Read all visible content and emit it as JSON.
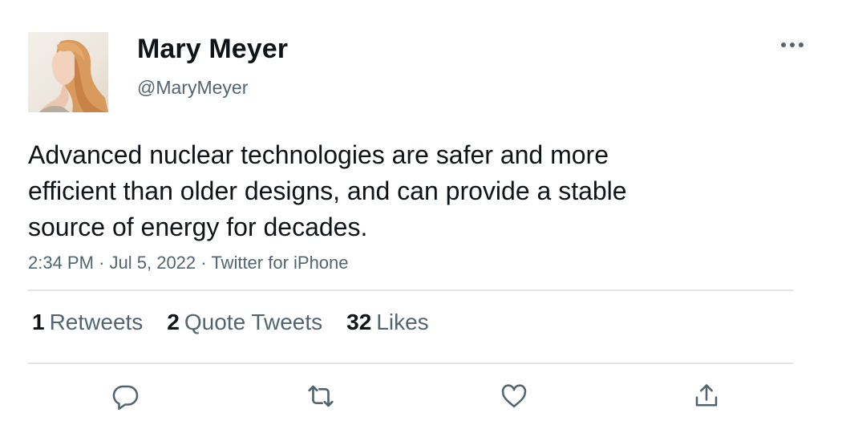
{
  "author": {
    "display_name": "Mary Meyer",
    "handle": "@MaryMeyer"
  },
  "tweet": {
    "text_lines": [
      "Advanced nuclear technologies are safer and more",
      "efficient than older designs, and can provide a stable",
      "source of energy for decades."
    ],
    "time": "2:34 PM",
    "date": "Jul 5, 2022",
    "source": "Twitter for iPhone",
    "separator": "·"
  },
  "stats": {
    "retweets": {
      "count": "1",
      "label": "Retweets"
    },
    "quotes": {
      "count": "2",
      "label": "Quote Tweets"
    },
    "likes": {
      "count": "32",
      "label": "Likes"
    }
  },
  "icons": {
    "more": "more-icon",
    "reply": "reply-icon",
    "retweet": "retweet-icon",
    "like": "like-icon",
    "share": "share-icon"
  },
  "colors": {
    "text_primary": "#0f1419",
    "text_secondary": "#536471",
    "divider": "#e1e6ea"
  }
}
